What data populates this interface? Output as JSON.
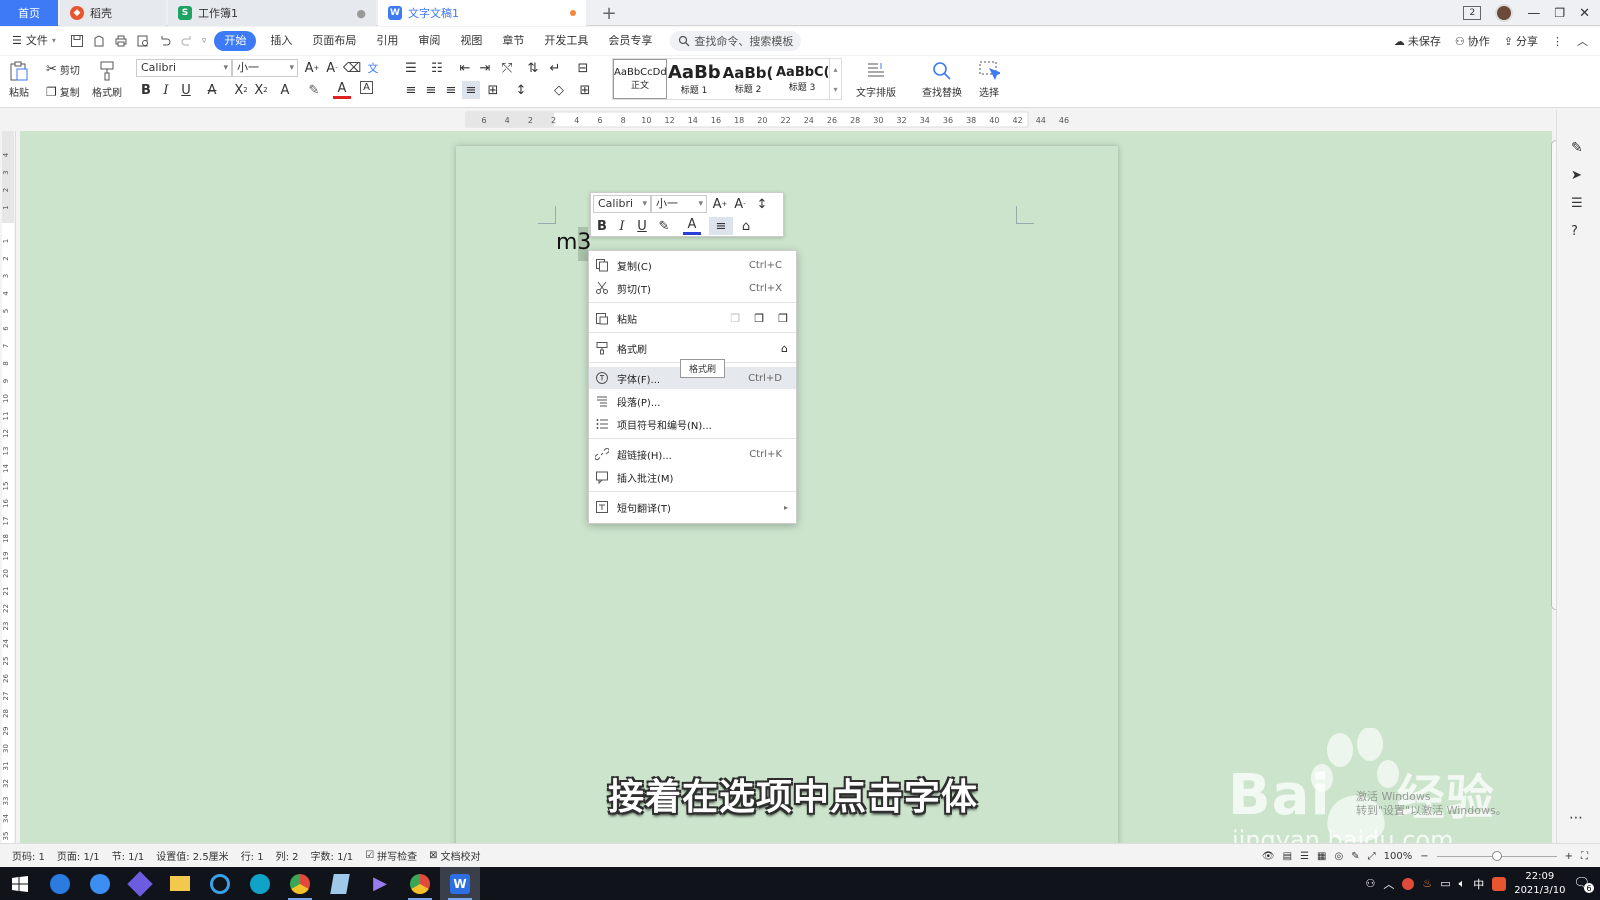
{
  "tabs": {
    "home": "首页",
    "daoke": "稻壳",
    "sheet": "工作簿1",
    "doc": "文字文稿1",
    "new_tab": "+"
  },
  "title_right": {
    "badge": "2"
  },
  "menu": {
    "file": "文件",
    "items": [
      "开始",
      "插入",
      "页面布局",
      "引用",
      "审阅",
      "视图",
      "章节",
      "开发工具",
      "会员专享"
    ],
    "search_placeholder": "查找命令、搜索模板",
    "unsaved": "未保存",
    "collab": "协作",
    "share": "分享"
  },
  "ribbon": {
    "paste": "粘贴",
    "cut": "剪切",
    "copy": "复制",
    "format_painter": "格式刷",
    "font_name": "Calibri",
    "font_size": "小一",
    "styles": [
      {
        "preview": "AaBbCcDd",
        "label": "正文"
      },
      {
        "preview": "AaBb",
        "label": "标题 1"
      },
      {
        "preview": "AaBb(",
        "label": "标题 2"
      },
      {
        "preview": "AaBbC(",
        "label": "标题 3"
      }
    ],
    "text_layout": "文字排版",
    "find_replace": "查找替换",
    "select": "选择"
  },
  "ruler": {
    "h_ticks": [
      "6",
      "4",
      "2",
      "2",
      "4",
      "6",
      "8",
      "10",
      "12",
      "14",
      "16",
      "18",
      "20",
      "22",
      "24",
      "26",
      "28",
      "30",
      "32",
      "34",
      "36",
      "38",
      "40",
      "42",
      "44",
      "46"
    ],
    "v_ticks_top": [
      "4",
      "3",
      "2",
      "1"
    ],
    "v_ticks": [
      "1",
      "2",
      "3",
      "4",
      "5",
      "6",
      "7",
      "8",
      "9",
      "10",
      "11",
      "12",
      "13",
      "14",
      "15",
      "16",
      "17",
      "18",
      "19",
      "20",
      "21",
      "22",
      "23",
      "24",
      "25",
      "26",
      "27",
      "28",
      "29",
      "30",
      "31",
      "32",
      "33",
      "34",
      "35"
    ]
  },
  "document": {
    "text": "m3"
  },
  "mini_toolbar": {
    "font_name": "Calibri",
    "font_size": "小一"
  },
  "context_menu": {
    "copy": {
      "label": "复制(C)",
      "shortcut": "Ctrl+C"
    },
    "cut": {
      "label": "剪切(T)",
      "shortcut": "Ctrl+X"
    },
    "paste": {
      "label": "粘贴"
    },
    "format_painter": {
      "label": "格式刷"
    },
    "font": {
      "label": "字体(F)...",
      "shortcut": "Ctrl+D"
    },
    "paragraph": {
      "label": "段落(P)..."
    },
    "bullets": {
      "label": "项目符号和编号(N)..."
    },
    "hyperlink": {
      "label": "超链接(H)...",
      "shortcut": "Ctrl+K"
    },
    "comment": {
      "label": "插入批注(M)"
    },
    "translate": {
      "label": "短句翻译(T)"
    }
  },
  "tooltip": "格式刷",
  "caption": "接着在选项中点击字体",
  "watermark": {
    "brand": "Bai",
    "brand2": "经验",
    "url": "jingyan.baidu.com",
    "activate1": "激活 Windows",
    "activate2": "转到\"设置\"以激活 Windows。"
  },
  "status": {
    "page_num": "页码: 1",
    "pages": "页面: 1/1",
    "section": "节: 1/1",
    "setting": "设置值: 2.5厘米",
    "row": "行: 1",
    "col": "列: 2",
    "words": "字数: 1/1",
    "spell": "拼写检查",
    "proof": "文档校对",
    "zoom": "100%"
  },
  "taskbar": {
    "time": "22:09",
    "date": "2021/3/10",
    "ime": "中",
    "notify_count": "6"
  },
  "colors": {
    "accent": "#3d7af5",
    "canvas": "#cce4cc",
    "taskbar": "#10131a",
    "dirty_dot": "#f08a3a"
  }
}
